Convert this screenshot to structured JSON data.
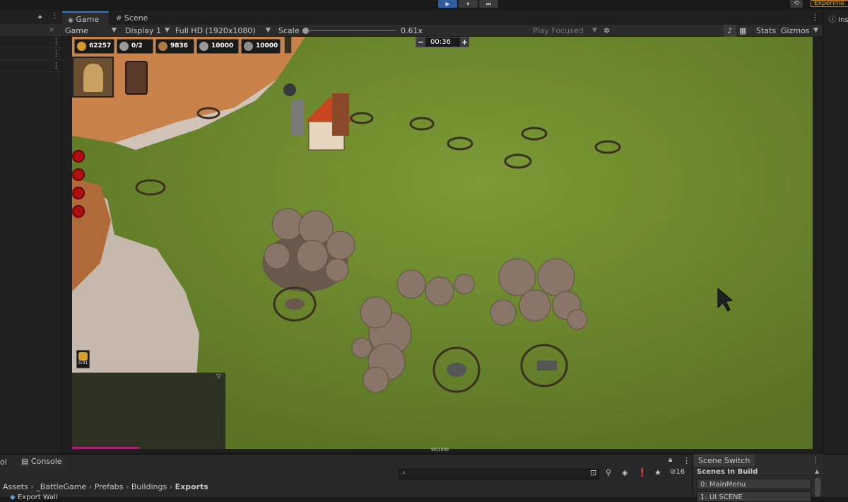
{
  "top": {
    "experiment_label": "Experime",
    "play": "▶",
    "pause": "⏸",
    "step": "⏭"
  },
  "tabs": {
    "game": "Game",
    "scene": "Scene",
    "inspector": "Ins"
  },
  "toolbar": {
    "view_mode": "Game",
    "display": "Display 1",
    "resolution": "Full HD (1920x1080)",
    "scale_label": "Scale",
    "scale_value": "0.61x",
    "play_focused": "Play Focused",
    "stats": "Stats",
    "gizmos": "Gizmos",
    "scale_fraction": 0.0
  },
  "hud": {
    "resources": [
      {
        "name": "gold",
        "value": "62257",
        "color": "#d89a2a"
      },
      {
        "name": "population",
        "value": "0/2",
        "color": "#9a9a9a"
      },
      {
        "name": "wood",
        "value": "9836",
        "color": "#b07a45"
      },
      {
        "name": "stone",
        "value": "10000",
        "color": "#9a9a9a"
      },
      {
        "name": "iron",
        "value": "10000",
        "color": "#8c8c8c"
      }
    ],
    "timer": "00:36",
    "minus": "−",
    "plus": "+",
    "unit_time": "5:01",
    "progress_text": "90/1000",
    "progress_fraction": 0.09,
    "minimap_toggle": "▽"
  },
  "bottom": {
    "left_tab_fragment": "ol",
    "console_tab": "Console",
    "breadcrumb": [
      "Assets",
      "_BattleGame",
      "Prefabs",
      "Buildings",
      "Exports"
    ],
    "search_placeholder": "",
    "hidden_count": "16",
    "row_label": "Export Wall"
  },
  "scene_switch": {
    "title": "Scene Switch",
    "subtitle": "Scenes In Build",
    "scenes": [
      "0: MainMenu",
      "1: UI SCENE"
    ]
  },
  "colors": {
    "accent": "#3a79bb",
    "play_active": "#2f5f9e",
    "grass": "#6f8a2e"
  }
}
